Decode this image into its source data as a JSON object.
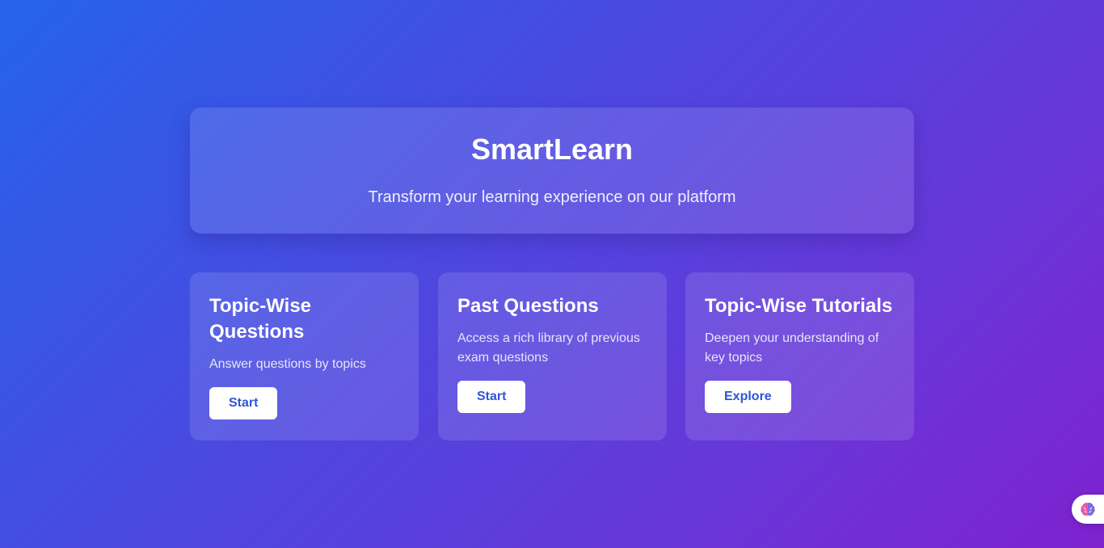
{
  "hero": {
    "title": "SmartLearn",
    "subtitle": "Transform your learning experience on our platform"
  },
  "cards": [
    {
      "title": "Topic-Wise Questions",
      "description": "Answer questions by topics",
      "button_label": "Start"
    },
    {
      "title": "Past Questions",
      "description": "Access a rich library of previous exam questions",
      "button_label": "Start"
    },
    {
      "title": "Topic-Wise Tutorials",
      "description": "Deepen your understanding of key topics",
      "button_label": "Explore"
    }
  ],
  "floating_button": {
    "icon": "brain-icon"
  },
  "colors": {
    "gradient_start": "#2563eb",
    "gradient_end": "#7e22ce",
    "button_text": "#2f55d4"
  }
}
